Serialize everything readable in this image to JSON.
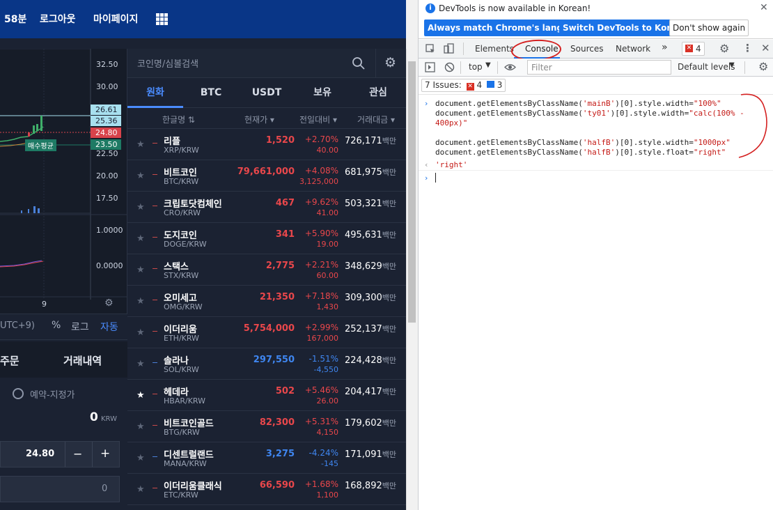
{
  "topbar": {
    "time_fragment": "58분",
    "logout": "로그아웃",
    "mypage": "마이페이지",
    "menu_icon": "grid-icon"
  },
  "chart": {
    "prices": [
      "32.50",
      "30.00",
      "26.61",
      "25.36",
      "24.80",
      "23.50",
      "22.50",
      "20.00",
      "17.50",
      "1.0000",
      "0.0000"
    ],
    "avg_label": "매수평균",
    "x_tick": "9",
    "colors": {
      "cyan": "#a8e0ef",
      "red": "#d8434b",
      "green": "#1e7a64"
    }
  },
  "chart_toolbar": {
    "tz": "UTC+9)",
    "percent": "%",
    "log": "로그",
    "auto": "자동"
  },
  "order": {
    "tab_order": "주문",
    "tab_history": "거래내역",
    "reserve_label": "예약-지정가",
    "available": "0",
    "available_unit": "KRW",
    "price_value": "24.80",
    "minus": "−",
    "plus": "+",
    "qty_value": "0"
  },
  "market": {
    "search_placeholder": "코인명/심볼검색",
    "tabs": [
      "원화",
      "BTC",
      "USDT",
      "보유",
      "관심"
    ],
    "active_tab": "원화",
    "columns": {
      "name": "한글명 ⇅",
      "price": "현재가 ▾",
      "change": "전일대비 ▾",
      "volume": "거래대금 ▾"
    },
    "rows": [
      {
        "name": "리플",
        "symbol": "XRP/KRW",
        "price": "1,520",
        "pct": "+2.70%",
        "chg": "40.00",
        "vol": "726,171",
        "unit": "백만",
        "dir": "up",
        "star": false
      },
      {
        "name": "비트코인",
        "symbol": "BTC/KRW",
        "price": "79,661,000",
        "pct": "+4.08%",
        "chg": "3,125,000",
        "vol": "681,975",
        "unit": "백만",
        "dir": "up",
        "star": false
      },
      {
        "name": "크립토닷컴체인",
        "symbol": "CRO/KRW",
        "price": "467",
        "pct": "+9.62%",
        "chg": "41.00",
        "vol": "503,321",
        "unit": "백만",
        "dir": "up",
        "star": false
      },
      {
        "name": "도지코인",
        "symbol": "DOGE/KRW",
        "price": "341",
        "pct": "+5.90%",
        "chg": "19.00",
        "vol": "495,631",
        "unit": "백만",
        "dir": "up",
        "star": false
      },
      {
        "name": "스택스",
        "symbol": "STX/KRW",
        "price": "2,775",
        "pct": "+2.21%",
        "chg": "60.00",
        "vol": "348,629",
        "unit": "백만",
        "dir": "up",
        "star": false
      },
      {
        "name": "오미세고",
        "symbol": "OMG/KRW",
        "price": "21,350",
        "pct": "+7.18%",
        "chg": "1,430",
        "vol": "309,300",
        "unit": "백만",
        "dir": "up",
        "star": false
      },
      {
        "name": "이더리움",
        "symbol": "ETH/KRW",
        "price": "5,754,000",
        "pct": "+2.99%",
        "chg": "167,000",
        "vol": "252,137",
        "unit": "백만",
        "dir": "up",
        "star": false
      },
      {
        "name": "솔라나",
        "symbol": "SOL/KRW",
        "price": "297,550",
        "pct": "-1.51%",
        "chg": "-4,550",
        "vol": "224,428",
        "unit": "백만",
        "dir": "down",
        "star": false
      },
      {
        "name": "헤데라",
        "symbol": "HBAR/KRW",
        "price": "502",
        "pct": "+5.46%",
        "chg": "26.00",
        "vol": "204,417",
        "unit": "백만",
        "dir": "up",
        "star": true
      },
      {
        "name": "비트코인골드",
        "symbol": "BTG/KRW",
        "price": "82,300",
        "pct": "+5.31%",
        "chg": "4,150",
        "vol": "179,602",
        "unit": "백만",
        "dir": "up",
        "star": false
      },
      {
        "name": "디센트럴랜드",
        "symbol": "MANA/KRW",
        "price": "3,275",
        "pct": "-4.24%",
        "chg": "-145",
        "vol": "171,091",
        "unit": "백만",
        "dir": "down",
        "star": false
      },
      {
        "name": "이더리움클래식",
        "symbol": "ETC/KRW",
        "price": "66,590",
        "pct": "+1.68%",
        "chg": "1,100",
        "vol": "168,892",
        "unit": "백만",
        "dir": "up",
        "star": false
      }
    ]
  },
  "devtools": {
    "notice": "DevTools is now available in Korean!",
    "btn_match": "Always match Chrome's language",
    "btn_switch": "Switch DevTools to Korean",
    "btn_dont": "Don't show again",
    "tabs": [
      "Elements",
      "Console",
      "Sources",
      "Network"
    ],
    "active_tab": "Console",
    "more": "»",
    "error_count": "4",
    "context": "top",
    "filter_placeholder": "Filter",
    "levels": "Default levels",
    "issues_label": "7 Issues:",
    "issues_errors": "4",
    "issues_info": "3",
    "console_lines": [
      [
        "document.getElementsByClassName(",
        "'mainB'",
        ")[0].style.width=",
        "\"100%\""
      ],
      [
        "document.getElementsByClassName(",
        "'ty01'",
        ")[0].style.width=",
        "\"calc(100% -"
      ],
      [
        "",
        "",
        "",
        "400px)\""
      ],
      [
        "document.getElementsByClassName(",
        "'halfB'",
        ")[0].style.width=",
        "\"1000px\""
      ],
      [
        "document.getElementsByClassName(",
        "'halfB'",
        ")[0].style.float=",
        "\"right\""
      ]
    ],
    "result": "'right'"
  }
}
